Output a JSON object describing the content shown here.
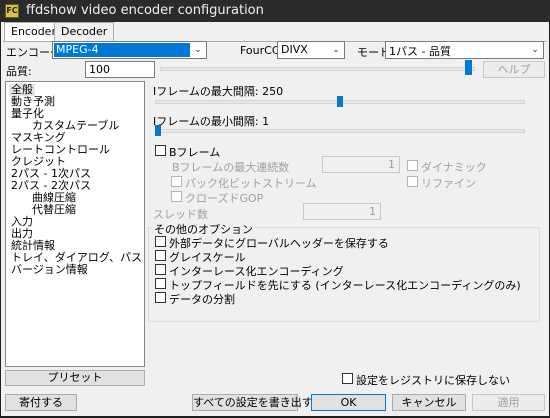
{
  "window": {
    "title": "ffdshow video encoder configuration",
    "icon_text": "FC"
  },
  "tabs": [
    {
      "label": "Encoder",
      "active": true
    },
    {
      "label": "Decoder",
      "active": false
    }
  ],
  "encoder": {
    "label": "エンコーダ",
    "value": "MPEG-4"
  },
  "fourcc": {
    "label": "FourCC:",
    "value": "DIVX"
  },
  "mode": {
    "label": "モード:",
    "value": "1パス - 品質"
  },
  "quality": {
    "label": "品質:",
    "value": "100",
    "slider_level_percent": 100
  },
  "help_button": "ヘルプ",
  "tree": [
    {
      "label": "全般",
      "selected": true
    },
    {
      "label": "動き予測"
    },
    {
      "label": "量子化"
    },
    {
      "label": "カスタムテーブル"
    },
    {
      "label": "マスキング"
    },
    {
      "label": "レートコントロール"
    },
    {
      "label": "クレジット"
    },
    {
      "label": "2パス - 1次パス"
    },
    {
      "label": "2パス - 2次パス"
    },
    {
      "label": "曲線圧縮"
    },
    {
      "label": "代替圧縮"
    },
    {
      "label": "入力"
    },
    {
      "label": "出力"
    },
    {
      "label": "統計情報"
    },
    {
      "label": "トレイ、ダイアログ、パス"
    },
    {
      "label": "バージョン情報"
    }
  ],
  "iframe_max": {
    "label": "Iフレームの最大間隔: 250",
    "slider_level_percent": 51
  },
  "iframe_min": {
    "label": "Iフレームの最小間隔: 1",
    "slider_level_percent": 0
  },
  "bframes": {
    "label": "Bフレーム",
    "max_consecutive_label": "Bフレームの最大連続数",
    "max_consecutive_value": "1",
    "dynamic_label": "ダイナミック",
    "packed_label": "パック化ビットストリーム",
    "refine_label": "リファイン",
    "closed_gop_label": "クローズドGOP"
  },
  "threads": {
    "label": "スレッド数",
    "value": "1"
  },
  "other_options": {
    "title": "その他のオプション",
    "items": [
      "外部データにグローバルヘッダーを保存する",
      "グレイスケール",
      "インターレース化エンコーディング",
      "トップフィールドを先にする (インターレース化エンコーディングのみ)",
      "データの分割"
    ]
  },
  "preset_button": "プリセット",
  "save_registry_label": "設定をレジストリに保存しない",
  "buttons": {
    "donate": "寄付する",
    "export_all": "すべての設定を書き出す",
    "ok": "OK",
    "cancel": "キャンセル",
    "apply": "適用"
  }
}
